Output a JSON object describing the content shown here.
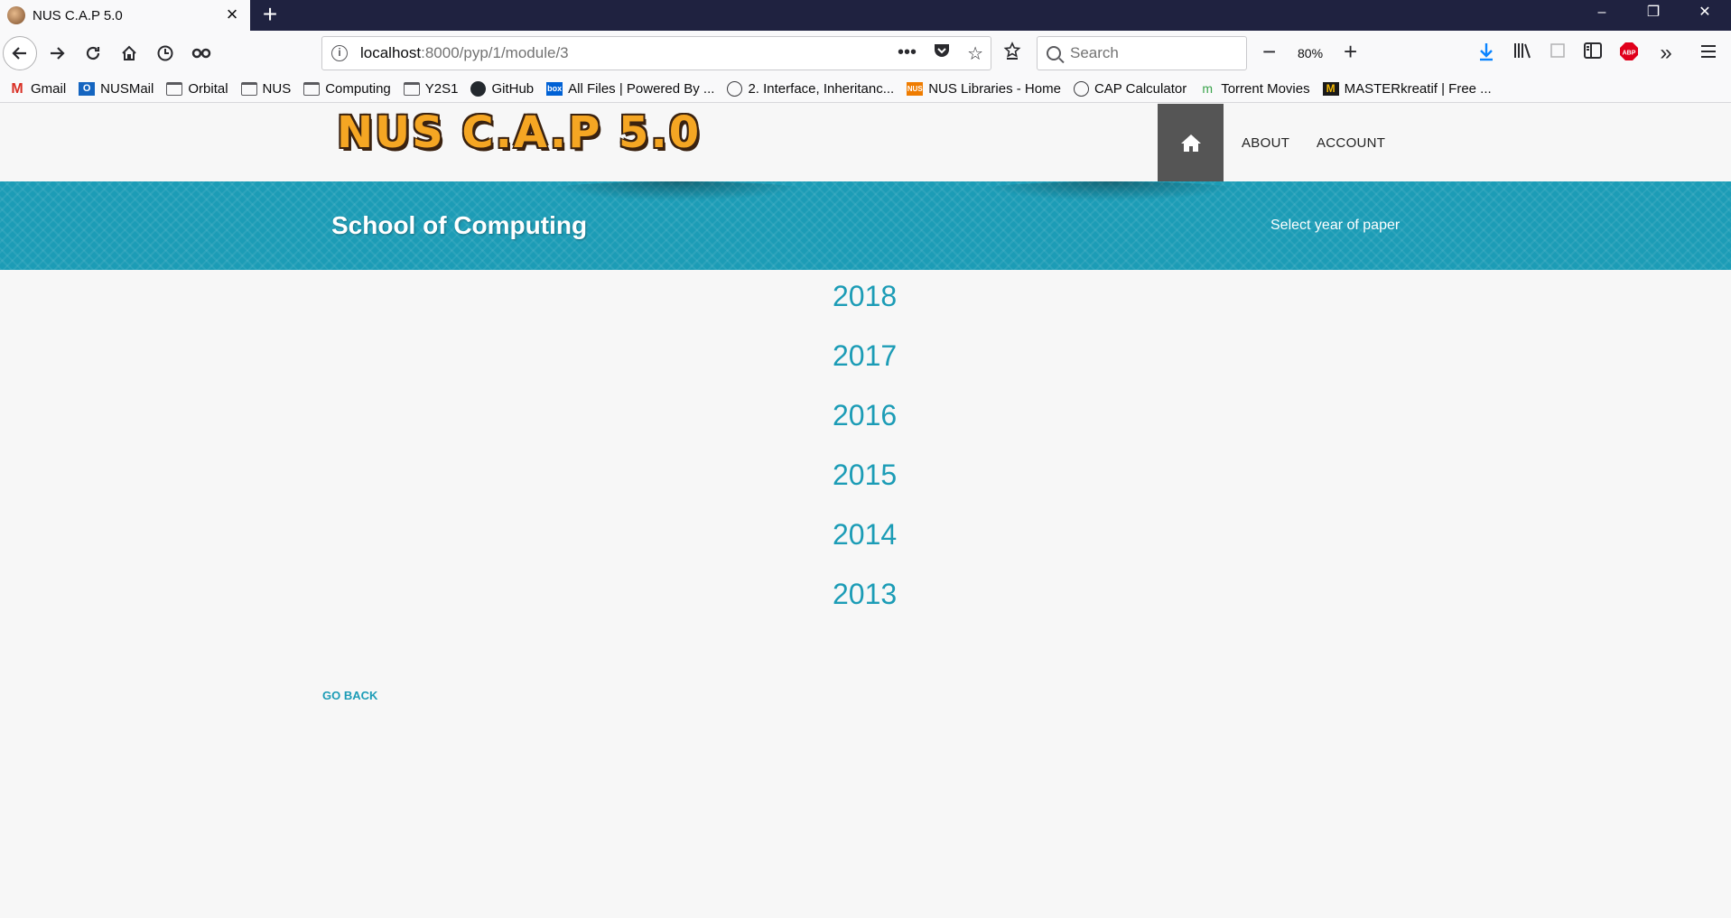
{
  "browser": {
    "tab_title": "NUS C.A.P 5.0",
    "url_host": "localhost",
    "url_rest": ":8000/pyp/1/module/3",
    "search_placeholder": "Search",
    "zoom": "80%",
    "bookmarks": [
      {
        "label": "Gmail",
        "icon": "gmail-icon"
      },
      {
        "label": "NUSMail",
        "icon": "outlook-icon"
      },
      {
        "label": "Orbital",
        "icon": "folder-icon"
      },
      {
        "label": "NUS",
        "icon": "folder-icon"
      },
      {
        "label": "Computing",
        "icon": "folder-icon"
      },
      {
        "label": "Y2S1",
        "icon": "folder-icon"
      },
      {
        "label": "GitHub",
        "icon": "github-icon"
      },
      {
        "label": "All Files | Powered By ...",
        "icon": "box-icon"
      },
      {
        "label": "2. Interface, Inheritanc...",
        "icon": "globe-icon"
      },
      {
        "label": "NUS Libraries - Home",
        "icon": "nus-icon"
      },
      {
        "label": "CAP Calculator",
        "icon": "globe-icon"
      },
      {
        "label": "Torrent Movies",
        "icon": "torrent-icon"
      },
      {
        "label": "MASTERkreatif | Free ...",
        "icon": "master-icon"
      }
    ]
  },
  "site": {
    "logo": "NUS C.A.P 5.0",
    "nav": {
      "about": "ABOUT",
      "account": "ACCOUNT"
    },
    "banner_title": "School of Computing",
    "banner_subtitle": "Select year of paper",
    "years": [
      "2018",
      "2017",
      "2016",
      "2015",
      "2014",
      "2013"
    ],
    "go_back": "GO BACK"
  },
  "colors": {
    "accent": "#1c9cb6",
    "titlebar": "#1f2240",
    "home_button": "#555555",
    "logo": "#f5a623"
  }
}
